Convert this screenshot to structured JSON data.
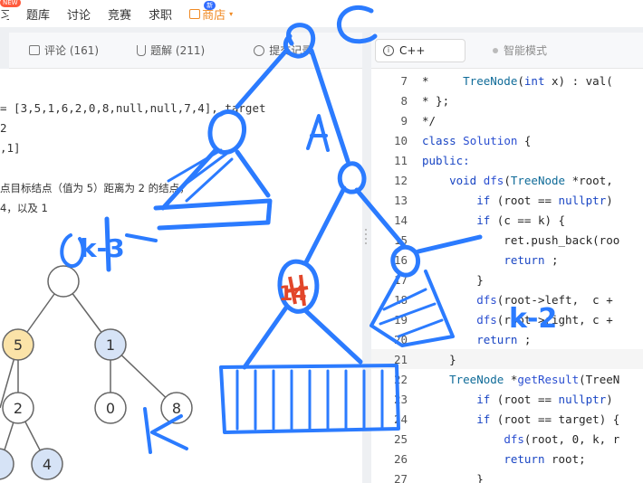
{
  "nav": {
    "items": [
      "习",
      "题库",
      "讨论",
      "竞赛",
      "求职"
    ],
    "badge": "NEW",
    "store": "商店",
    "store_badge": "新"
  },
  "tabs": {
    "comments": "评论 (161)",
    "solutions": "题解 (211)",
    "submissions": "提交记录"
  },
  "description": {
    "input_line": "= [3,5,1,6,2,0,8,null,null,7,4], target",
    "k_line": "2",
    "output_line": ",1]",
    "explain_line1": "点目标结点（值为 5）距离为 2 的结点，",
    "explain_line2": "4，以及 1"
  },
  "tree": {
    "nodes": [
      {
        "value": "5",
        "color": "#fbe3a8"
      },
      {
        "value": "1",
        "color": "#d6e3f6"
      },
      {
        "value": "2",
        "color": "#ffffff"
      },
      {
        "value": "0",
        "color": "#ffffff"
      },
      {
        "value": "8",
        "color": "#ffffff"
      },
      {
        "value": "4",
        "color": "#d6e3f6"
      }
    ]
  },
  "editor": {
    "language": "C++",
    "smart_mode": "智能模式",
    "lines": [
      {
        "n": "7",
        "text": "*     TreeNode(int x) : val("
      },
      {
        "n": "8",
        "text": "* };"
      },
      {
        "n": "9",
        "text": "*/"
      },
      {
        "n": "10",
        "text": "class Solution {"
      },
      {
        "n": "11",
        "text": "public:"
      },
      {
        "n": "12",
        "text": "    void dfs(TreeNode *root,"
      },
      {
        "n": "13",
        "text": "        if (root == nullptr)"
      },
      {
        "n": "14",
        "text": "        if (c == k) {"
      },
      {
        "n": "15",
        "text": "            ret.push_back(roo"
      },
      {
        "n": "16",
        "text": "            return ;"
      },
      {
        "n": "17",
        "text": "        }"
      },
      {
        "n": "18",
        "text": "        dfs(root->left,  c +"
      },
      {
        "n": "19",
        "text": "        dfs(root->right, c +"
      },
      {
        "n": "20",
        "text": "        return ;"
      },
      {
        "n": "21",
        "text": "    }"
      },
      {
        "n": "22",
        "text": "    TreeNode *getResult(TreeN"
      },
      {
        "n": "23",
        "text": "        if (root == nullptr)"
      },
      {
        "n": "24",
        "text": "        if (root == target) {"
      },
      {
        "n": "25",
        "text": "            dfs(root, 0, k, r"
      },
      {
        "n": "26",
        "text": "            return root;"
      },
      {
        "n": "27",
        "text": "        }"
      }
    ]
  },
  "annotations": {
    "c_label": "C",
    "k3": "k-3",
    "k2": "k-2",
    "n14": "14",
    "k_label": "k"
  },
  "colors": {
    "ink_blue": "#2b7bff",
    "ink_red": "#e2462a",
    "store_orange": "#f08a24"
  }
}
